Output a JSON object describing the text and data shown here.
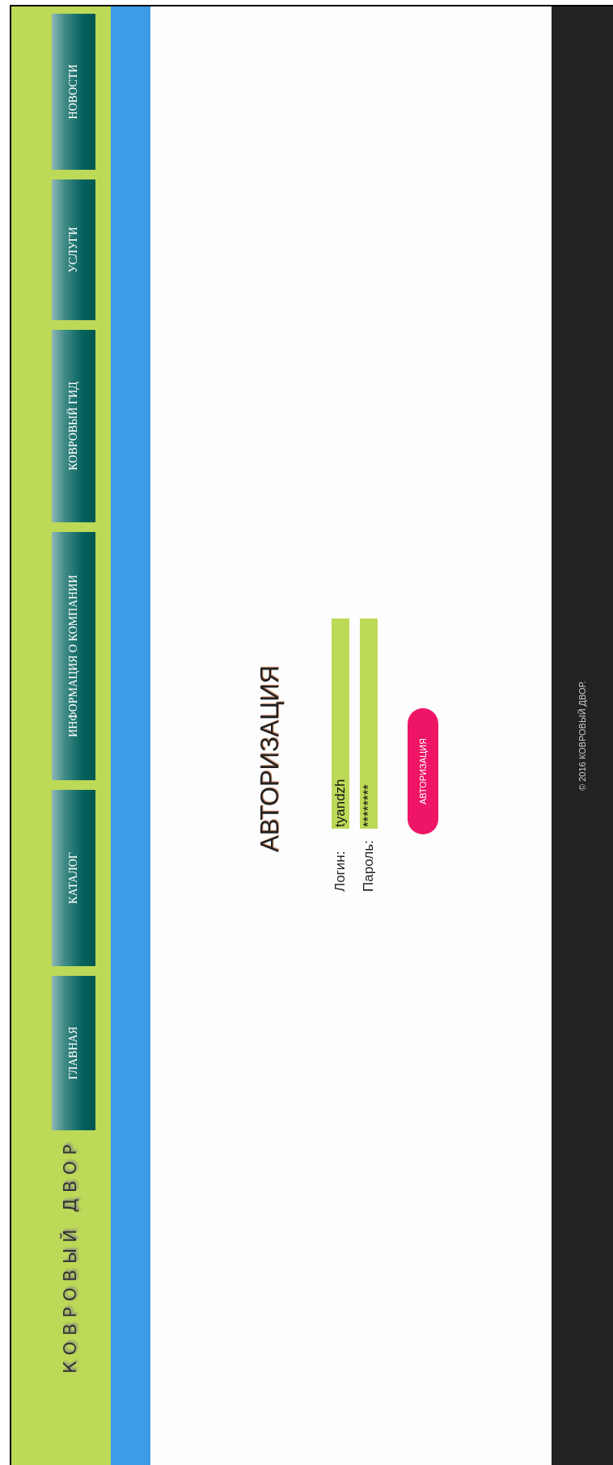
{
  "header": {
    "logo": "КОВРОВЫЙ ДВОР",
    "nav": [
      {
        "label": "ГЛАВНАЯ"
      },
      {
        "label": "КАТАЛОГ"
      },
      {
        "label": "ИНФОРМАЦИЯ О КОМПАНИИ"
      },
      {
        "label": "КОВРОВЫЙ ГИД"
      },
      {
        "label": "УСЛУГИ"
      },
      {
        "label": "НОВОСТИ"
      }
    ]
  },
  "auth": {
    "title": "АВТОРИЗАЦИЯ",
    "fields": [
      {
        "label": "Логин:",
        "value": "tyandzh"
      },
      {
        "label": "Пароль:",
        "value": "********"
      }
    ],
    "button": "АВТОРИЗАЦИЯ"
  },
  "footer": "© 2016 КОВРОВЫЙ ДВОР."
}
